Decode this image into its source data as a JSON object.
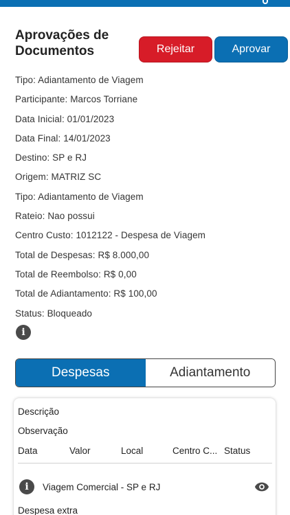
{
  "page": {
    "title": "Aprovações de Documentos"
  },
  "actions": {
    "reject_label": "Rejeitar",
    "approve_label": "Aprovar"
  },
  "colors": {
    "primary_blue": "#0b6fb3",
    "reject_red": "#d71c28",
    "icon_gray": "#4a4a4a"
  },
  "details": [
    "Tipo: Adiantamento de Viagem",
    "Participante: Marcos Torriane",
    "Data Inicial: 01/01/2023",
    "Data Final: 14/01/2023",
    "Destino: SP e RJ",
    "Origem: MATRIZ SC",
    "Tipo: Adiantamento de Viagem",
    "Rateio: Nao possui",
    "Centro Custo: 1012122 - Despesa de Viagem",
    "Total de Despesas: R$ 8.000,00",
    "Total de Reembolso: R$ 0,00",
    "Total de Adiantamento: R$ 100,00",
    "Status: Bloqueado"
  ],
  "icons": {
    "info": "info-icon",
    "view": "eye-icon"
  },
  "tabs": [
    {
      "label": "Despesas",
      "active": true
    },
    {
      "label": "Adiantamento",
      "active": false
    }
  ],
  "card": {
    "descricao_label": "Descrição",
    "observacao_label": "Observação",
    "columns": [
      "Data",
      "Valor",
      "Local",
      "Centro C...",
      "Status"
    ],
    "item_title": "Viagem Comercial - SP e RJ",
    "item_subtitle": "Despesa extra"
  }
}
